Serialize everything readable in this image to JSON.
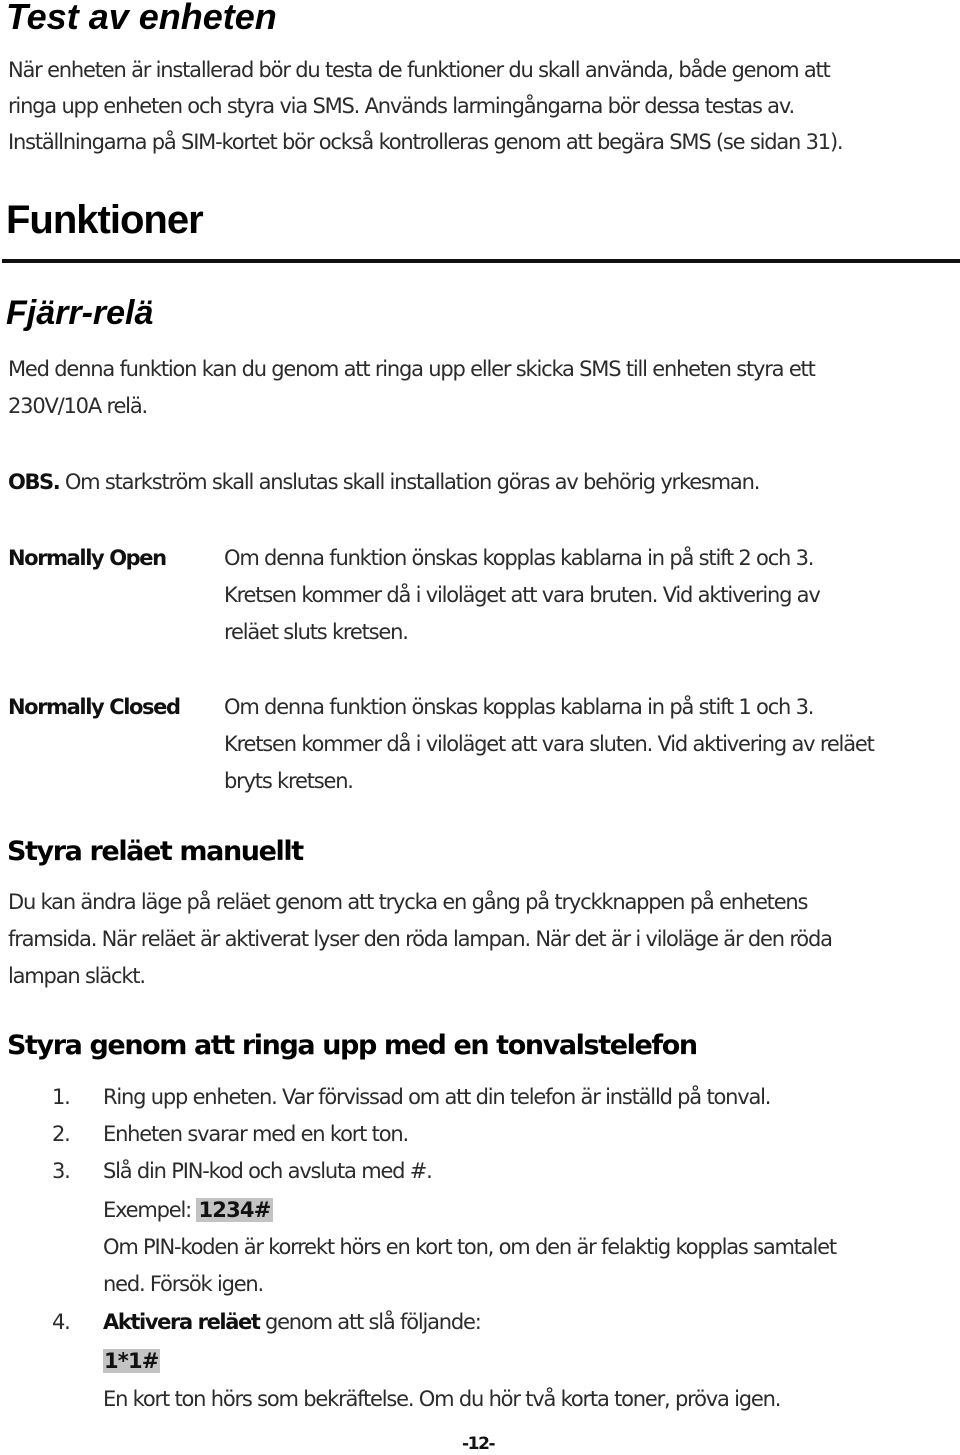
{
  "section_test": {
    "title": "Test av enheten",
    "lines": [
      "När enheten är installerad bör du testa de funktioner du skall använda, både genom att",
      "ringa upp enheten och styra via SMS. Används larmingångarna bör dessa testas av.",
      "Inställningarna på SIM-kortet bör också kontrolleras genom att begära SMS (se sidan 31)."
    ]
  },
  "section_funktioner": {
    "title": "Funktioner"
  },
  "section_fjarrrela": {
    "title": "Fjärr-relä",
    "lines": [
      "Med denna funktion kan du genom att ringa upp eller skicka SMS till enheten styra ett",
      "230V/10A relä."
    ],
    "obs_label": "OBS.",
    "obs_text": " Om starkström skall anslutas skall installation göras av behörig yrkesman."
  },
  "modes": [
    {
      "label": "Normally Open",
      "lines": [
        "Om denna funktion önskas kopplas kablarna in på stift 2 och 3.",
        "Kretsen kommer då i viloläget att vara bruten. Vid aktivering av",
        "reläet sluts kretsen."
      ]
    },
    {
      "label": "Normally Closed",
      "lines": [
        "Om denna funktion önskas kopplas kablarna in på stift 1 och 3.",
        "Kretsen kommer då i viloläget att vara sluten. Vid aktivering av reläet",
        "bryts kretsen."
      ]
    }
  ],
  "section_manuellt": {
    "title": "Styra reläet manuellt",
    "lines": [
      "Du kan ändra läge på reläet genom att trycka en gång på tryckknappen på enhetens",
      "framsida. När reläet är aktiverat lyser den röda lampan. När det är i viloläge är den röda",
      "lampan släckt."
    ]
  },
  "section_tonval": {
    "title": "Styra genom att ringa upp med en tonvalstelefon",
    "steps": [
      {
        "num": "1.",
        "text": "Ring upp enheten. Var förvissad om att din telefon är inställd på tonval."
      },
      {
        "num": "2.",
        "text": "Enheten svarar med en kort ton."
      },
      {
        "num": "3.",
        "text": "Slå din PIN-kod och avsluta med #.",
        "example_label": "Exempel: ",
        "example_code": "1234#",
        "note_lines": [
          "Om PIN-koden är korrekt hörs en kort ton, om den är felaktig kopplas samtalet",
          "ned. Försök igen."
        ]
      },
      {
        "num": "4.",
        "bold": "Aktivera reläet",
        "text": " genom att slå följande:",
        "code": "1*1#",
        "note": "En kort ton hörs som bekräftelse.  Om du hör två korta toner, pröva igen."
      }
    ]
  },
  "page_number": "-12-",
  "colors": {
    "text": "#2b2b2b",
    "heading": "#000000",
    "highlight": "#c3c3c3"
  }
}
